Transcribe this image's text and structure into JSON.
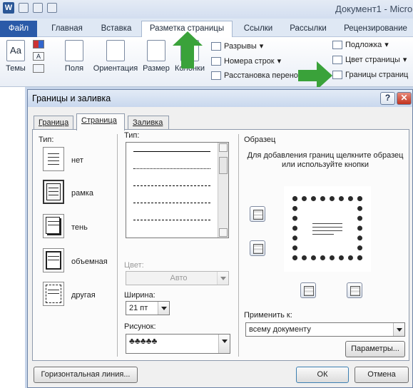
{
  "window": {
    "title": "Документ1  -  Micro"
  },
  "ribbon_tabs": [
    {
      "label": "Файл"
    },
    {
      "label": "Главная"
    },
    {
      "label": "Вставка"
    },
    {
      "label": "Разметка страницы"
    },
    {
      "label": "Ссылки"
    },
    {
      "label": "Рассылки"
    },
    {
      "label": "Рецензирование"
    }
  ],
  "ribbon": {
    "themes": "Темы",
    "fields": "Поля",
    "orientation": "Ориентация",
    "size": "Размер",
    "columns": "Колонки",
    "breaks": "Разрывы",
    "line_numbers": "Номера строк",
    "hyphenation": "Расстановка перено",
    "watermark": "Подложка",
    "page_color": "Цвет страницы",
    "page_borders": "Границы страниц"
  },
  "dialog": {
    "title": "Границы и заливка",
    "help_glyph": "?",
    "close_glyph": "✕",
    "tabs": [
      "Граница",
      "Страница",
      "Заливка"
    ],
    "type_label": "Тип:",
    "settings": [
      "нет",
      "рамка",
      "тень",
      "объемная",
      "другая"
    ],
    "style_label": "Тип:",
    "color_label": "Цвет:",
    "color_value": "Авто",
    "width_label": "Ширина:",
    "width_value": "21 пт",
    "art_label": "Рисунок:",
    "preview_group": "Образец",
    "preview_hint": "Для добавления границ щелкните образец или используйте кнопки",
    "apply_label": "Применить к:",
    "apply_value": "всему документу",
    "options_button": "Параметры...",
    "horizontal_line_button": "Горизонтальная линия...",
    "ok_button": "ОК",
    "cancel_button": "Отмена"
  },
  "colors": {
    "arrow": "#3aa23a",
    "file_tab": "#2a5aa8",
    "close": "#c2331e"
  }
}
